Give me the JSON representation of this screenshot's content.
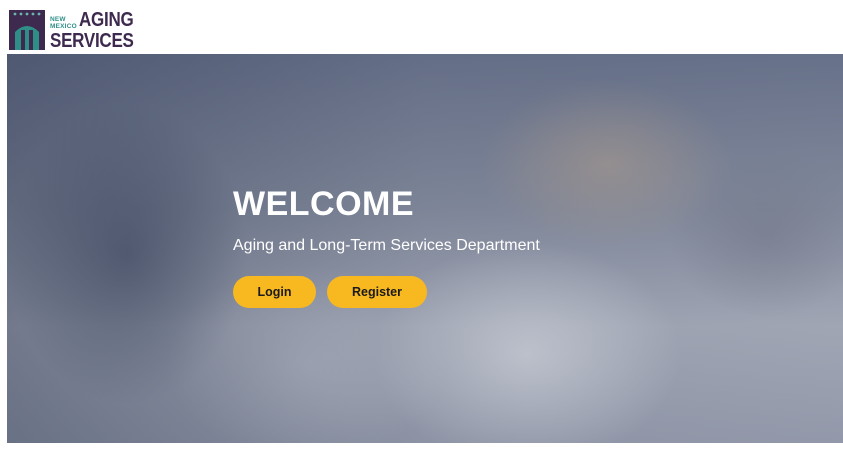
{
  "header": {
    "logo": {
      "icon": "building-arch-icon",
      "small_line1": "NEW",
      "small_line2": "MEXICO",
      "word1": "AGING",
      "word2": "SERVICES",
      "colors": {
        "purple": "#3d2a4e",
        "teal": "#2f8f88"
      }
    }
  },
  "hero": {
    "title": "WELCOME",
    "subtitle": "Aging and Long-Term Services Department",
    "buttons": {
      "login": "Login",
      "register": "Register"
    },
    "button_color": "#f8b820"
  }
}
